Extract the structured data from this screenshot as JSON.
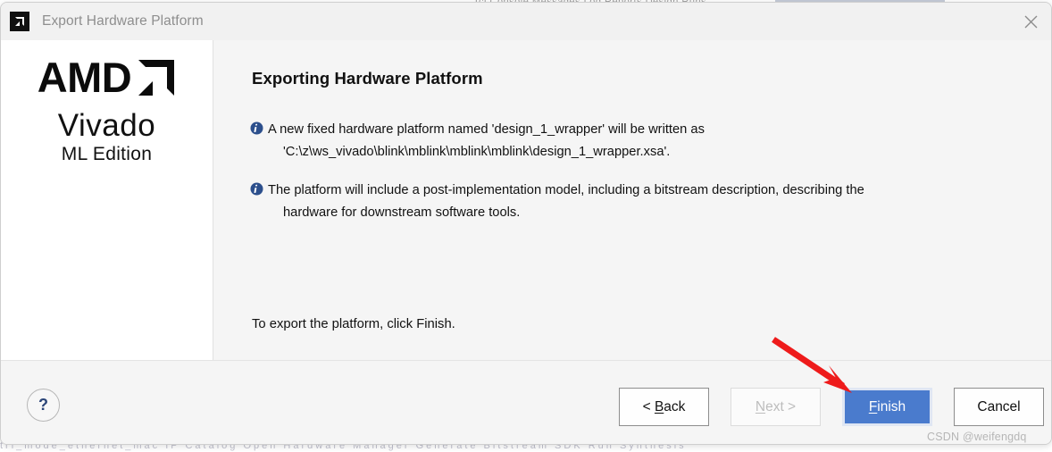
{
  "window": {
    "title": "Export Hardware Platform",
    "app_icon": "amd-arrow-icon",
    "close_icon": "close-icon"
  },
  "logo": {
    "brand": "AMD",
    "brand_mark": "amd-arrow-logo",
    "product": "Vivado",
    "edition": "ML Edition"
  },
  "content": {
    "page_title": "Exporting Hardware Platform",
    "info_items": [
      {
        "icon": "info-icon",
        "line1": "A new fixed hardware platform named 'design_1_wrapper' will be written as",
        "line2": "'C:\\z\\ws_vivado\\blink\\mblink\\mblink\\mblink\\design_1_wrapper.xsa'."
      },
      {
        "icon": "info-icon",
        "line1": "The platform will include a post-implementation model, including a bitstream description, describing the",
        "line2": "hardware for downstream software tools."
      }
    ],
    "finish_note": "To export the platform, click Finish."
  },
  "footer": {
    "help_label": "?",
    "buttons": [
      {
        "name": "back",
        "label": "< Back",
        "accel": "B",
        "state": "enabled"
      },
      {
        "name": "next",
        "label": "Next >",
        "accel": "N",
        "state": "disabled"
      },
      {
        "name": "finish",
        "label": "Finish",
        "accel": "F",
        "state": "primary"
      },
      {
        "name": "cancel",
        "label": "Cancel",
        "accel": "",
        "state": "enabled"
      }
    ]
  },
  "annotation": {
    "arrow_color": "#ee1b1b",
    "arrow_target": "finish-button"
  },
  "watermark": "CSDN @weifengdq",
  "background": {
    "toolbar_hint": "Tcl Console   Messages   Log   Reports   Design Runs",
    "bottom_hint": "tri_mode_ethernet_mac   IP Catalog   Open Hardware Manager   Generate Bitstream   SDK   Run Synthesis",
    "accent_green": "#2faf3e",
    "accent_blue": "#c3c9d6"
  },
  "colors": {
    "dialog_bg": "#f5f5f5",
    "panel_bg": "#ffffff",
    "primary_button": "#4a7bcd",
    "info_icon": "#2c4f8c",
    "help_glyph": "#2b4578"
  }
}
